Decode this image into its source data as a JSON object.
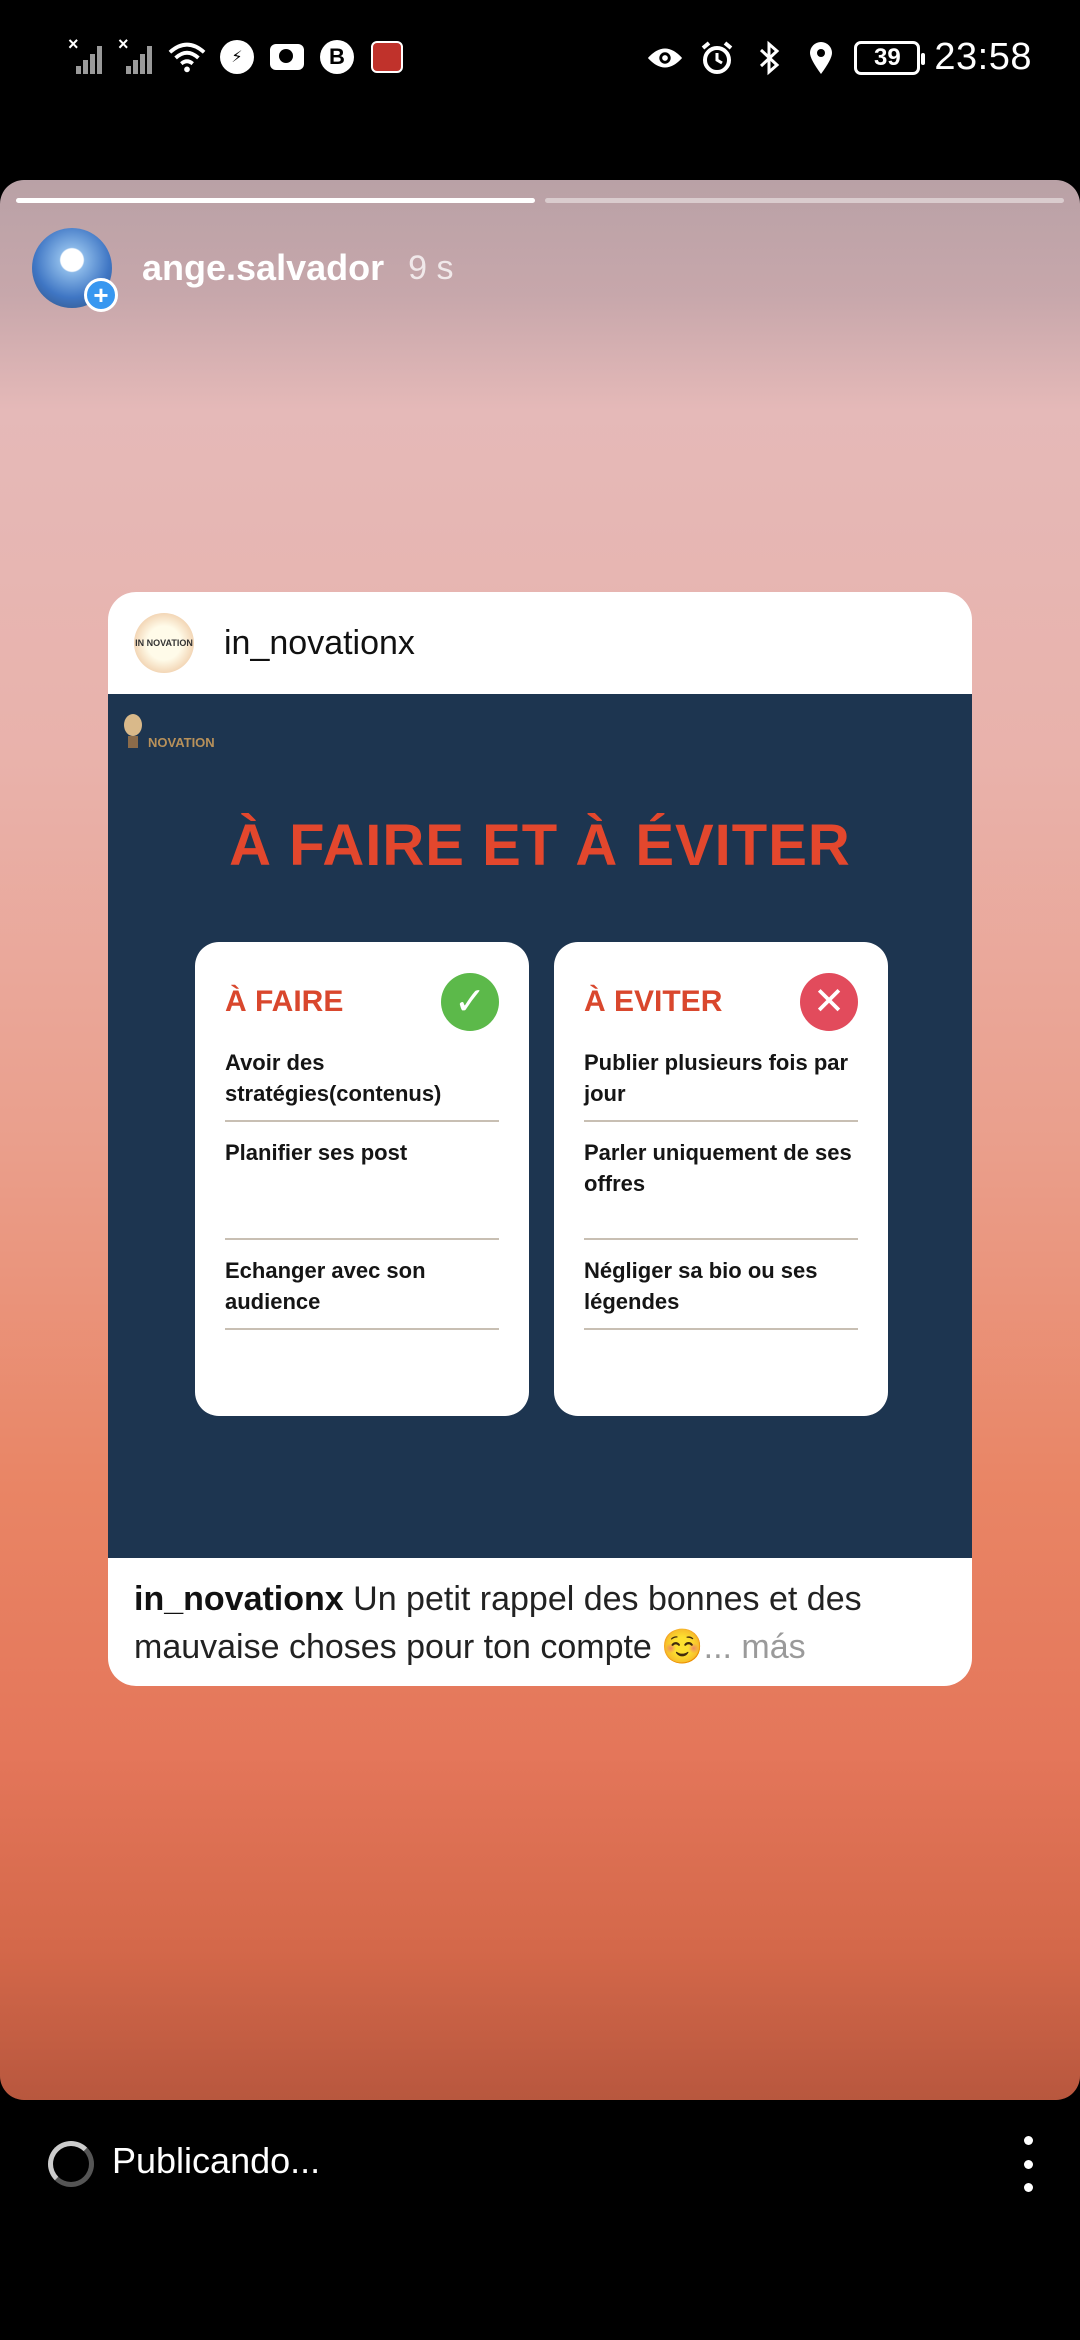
{
  "status_bar": {
    "time": "23:58",
    "battery": "39",
    "icons_left": [
      "signal-1-icon",
      "signal-2-icon",
      "wifi-icon",
      "messenger-icon",
      "camera-icon",
      "bitcoin-icon",
      "app-icon"
    ],
    "icons_right": [
      "eye-icon",
      "alarm-icon",
      "bluetooth-icon",
      "location-icon",
      "battery-icon"
    ]
  },
  "story": {
    "username": "ange.salvador",
    "time_ago": "9 s",
    "progress_segments": 2,
    "active_segment": 1
  },
  "post": {
    "username": "in_novationx",
    "avatar_text": "IN NOVATION",
    "brand_text": "NOVATION",
    "image_title": "À FAIRE ET À ÉVITER",
    "do_title": "À FAIRE",
    "do_items": [
      "Avoir des stratégies(contenus)",
      "Planifier ses post",
      "Echanger avec son audience"
    ],
    "avoid_title": "À EVITER",
    "avoid_items": [
      "Publier plusieurs fois par jour",
      "Parler uniquement de ses offres",
      "Négliger sa bio ou ses légendes"
    ],
    "caption_user": "in_novationx",
    "caption_text": " Un petit rappel des bonnes et des mauvaise choses pour ton compte ☺️",
    "caption_more": "... más"
  },
  "bottom": {
    "status": "Publicando..."
  },
  "colors": {
    "title_red": "#e3472d",
    "image_bg": "#1d3550",
    "check_green": "#5cb94a",
    "cross_red": "#e24b5c"
  }
}
